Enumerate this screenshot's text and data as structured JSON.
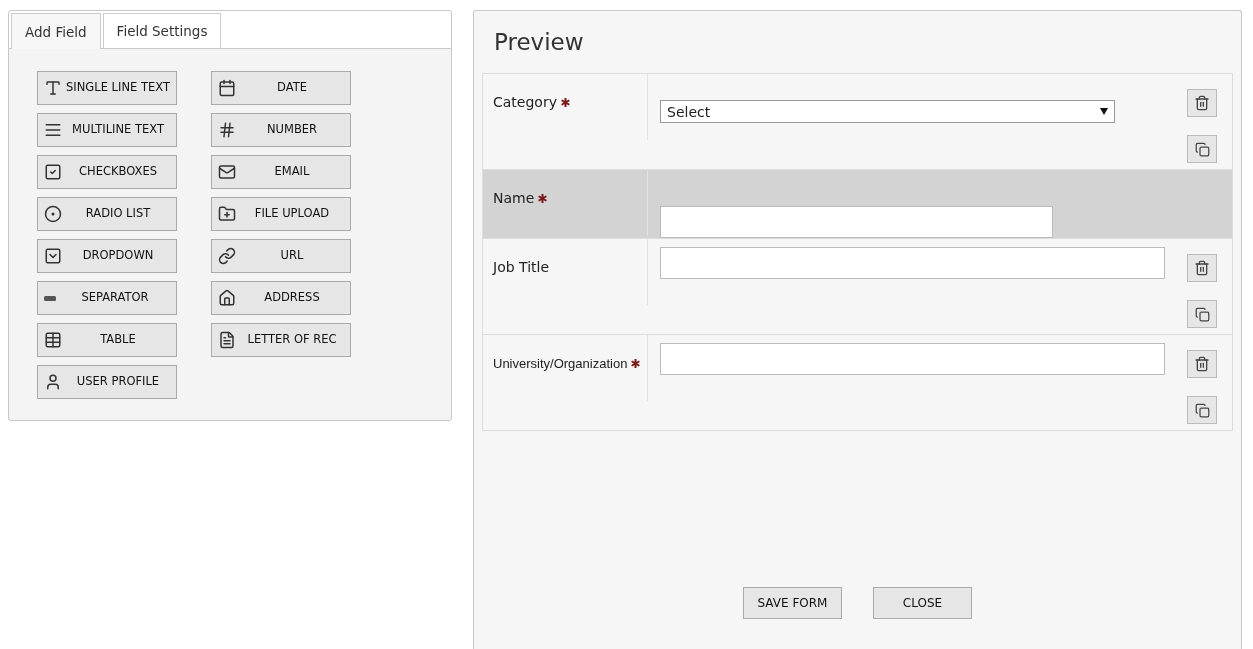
{
  "tabs": [
    {
      "label": "Add Field",
      "selected": true
    },
    {
      "label": "Field Settings",
      "selected": false
    }
  ],
  "field_buttons": [
    {
      "label": "SINGLE LINE TEXT",
      "kind": "text"
    },
    {
      "label": "DATE",
      "kind": "date"
    },
    {
      "label": "MULTILINE TEXT",
      "kind": "multiline"
    },
    {
      "label": "NUMBER",
      "kind": "number"
    },
    {
      "label": "CHECKBOXES",
      "kind": "checkbox"
    },
    {
      "label": "EMAIL",
      "kind": "email"
    },
    {
      "label": "RADIO LIST",
      "kind": "radio"
    },
    {
      "label": "FILE UPLOAD",
      "kind": "file"
    },
    {
      "label": "DROPDOWN",
      "kind": "dropdown"
    },
    {
      "label": "URL",
      "kind": "url"
    },
    {
      "label": "SEPARATOR",
      "kind": "separator"
    },
    {
      "label": "ADDRESS",
      "kind": "address"
    },
    {
      "label": "TABLE",
      "kind": "table"
    },
    {
      "label": "LETTER OF REC",
      "kind": "letter"
    },
    {
      "label": "USER PROFILE",
      "kind": "user"
    }
  ],
  "preview": {
    "title": "Preview",
    "fields": [
      {
        "label": "Category",
        "required": true,
        "kind": "select",
        "value": "Select",
        "selected": false
      },
      {
        "label": "Name",
        "required": true,
        "kind": "text",
        "selected": true
      },
      {
        "label": "Job Title",
        "required": false,
        "kind": "text",
        "selected": false
      },
      {
        "label": "University/Organization",
        "required": true,
        "kind": "text",
        "selected": false
      }
    ],
    "buttons": [
      "SAVE FORM",
      "CLOSE"
    ]
  }
}
